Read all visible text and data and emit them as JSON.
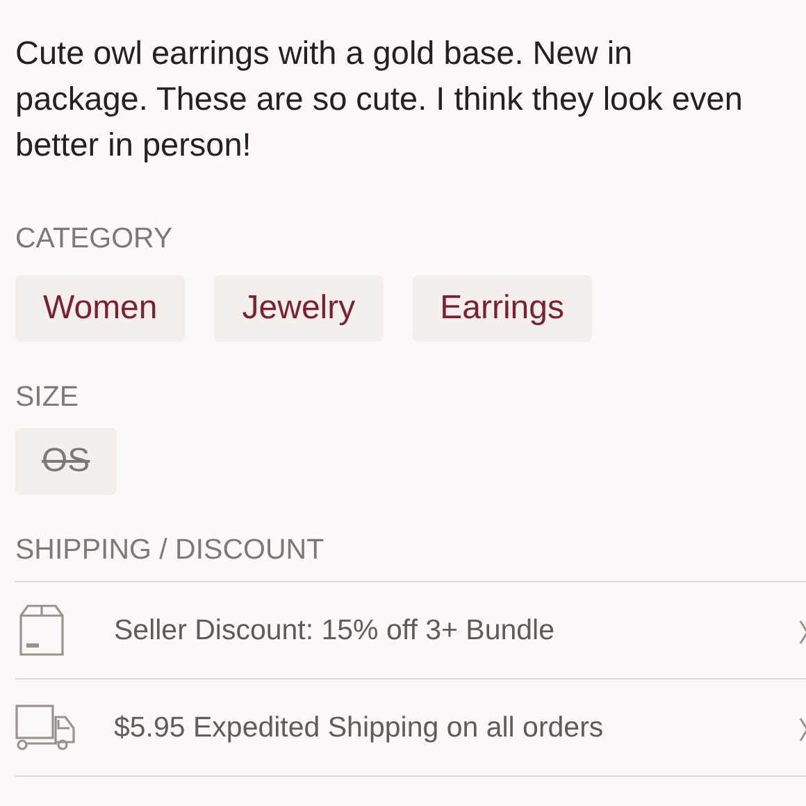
{
  "description": "Cute owl earrings with a gold base. New in package. These are so cute. I think they look even better in person!",
  "category": {
    "heading": "CATEGORY",
    "chips": [
      {
        "label": "Women"
      },
      {
        "label": "Jewelry"
      },
      {
        "label": "Earrings"
      }
    ]
  },
  "size": {
    "heading": "SIZE",
    "options": [
      {
        "label": "OS",
        "available": false
      }
    ]
  },
  "shipping_discount": {
    "heading": "SHIPPING / DISCOUNT",
    "rows": [
      {
        "kind": "discount",
        "text": "Seller Discount: 15% off 3+ Bundle"
      },
      {
        "kind": "shipping",
        "text": "$5.95 Expedited Shipping on all orders"
      }
    ]
  }
}
